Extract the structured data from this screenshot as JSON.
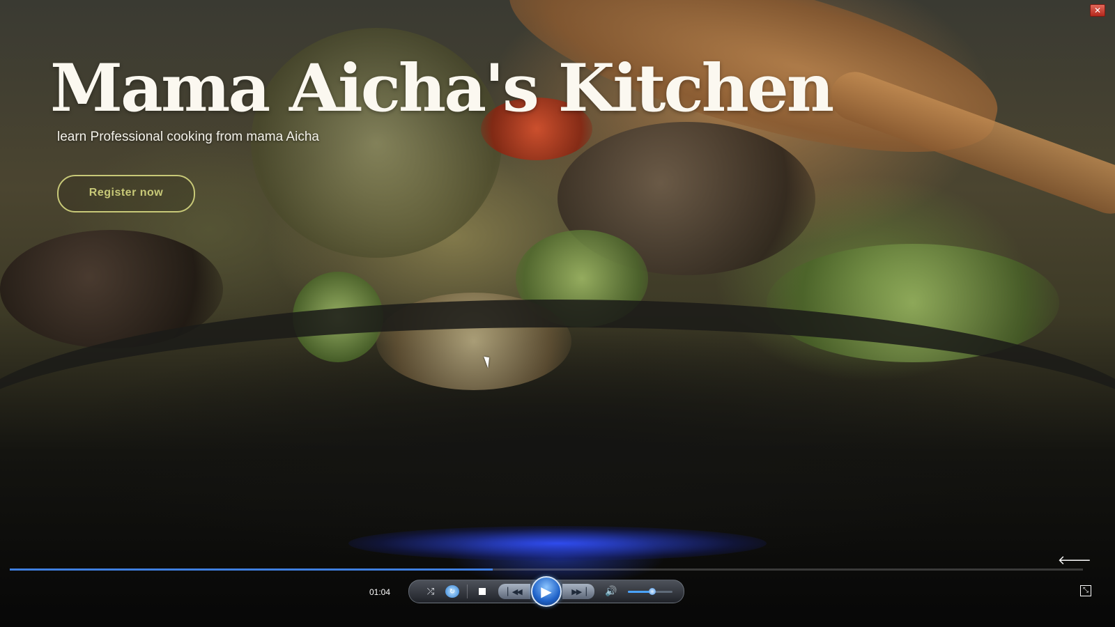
{
  "window": {
    "close_glyph": "✕"
  },
  "hero": {
    "title": "Mama Aicha's Kitchen",
    "subtitle": "learn Professional cooking from mama Aicha",
    "register_label": "Register now"
  },
  "player": {
    "time": "01:04",
    "progress_fraction": 0.45,
    "volume_fraction": 0.55,
    "accent_color": "#3f7fe0",
    "icons": {
      "back": "back-arrow-icon",
      "shuffle": "shuffle-icon",
      "repeat": "repeat-icon",
      "stop": "stop-icon",
      "previous": "previous-icon",
      "play": "play-icon",
      "next": "next-icon",
      "mute": "speaker-icon",
      "fullscreen": "switch-to-library-icon"
    }
  },
  "colors": {
    "title_text": "#fbf8f0",
    "button_outline": "#c8c978"
  }
}
